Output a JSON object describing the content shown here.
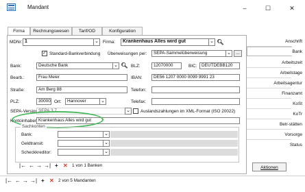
{
  "window": {
    "title": "Mandant",
    "minimize": "–",
    "maximize": "☐",
    "close": "✕"
  },
  "tabs": [
    "Firma",
    "Rechnungswesen",
    "Tarif/OD",
    "Konfiguration"
  ],
  "form": {
    "mdnr_label": "MDNr:",
    "mdnr_value": "1",
    "firma_label": "Firma:",
    "firma_value": "Krankenhaus Alles wird gut",
    "standard_bank_label": "Standard-Bankverbindung",
    "ueberweisungen_label": "Überweisungen per:",
    "ueberweisungen_value": "SEPA-Sammelüberweisung",
    "ellipsis_label": "...",
    "bank_label": "Bank:",
    "bank_value": "Deutsche Bank",
    "blz_label": "BLZ:",
    "blz_value": "12070000",
    "bic_label": "BIC:",
    "bic_value": "DEUTDEBB120",
    "bearb_label": "Bearb.:",
    "bearb_value": "Frau Meier",
    "iban_label": "IBAN:",
    "iban_value": "DE56 1207 0000 0099 9991 23",
    "strasse_label": "Straße:",
    "strasse_value": "Am Berg 88",
    "telefon_label": "Telefon:",
    "telefon_value": "",
    "plz_label": "PLZ:",
    "plz_value": "30000",
    "ort_label": "Ort:",
    "ort_value": "Hannover",
    "telefax_label": "Telefax:",
    "telefax_value": "",
    "sepa_version_label": "SEPA-Version:",
    "sepa_version_value": "SEPA 3.7",
    "ausland_label": "Auslandszahlungen im XML-Format (ISO 20022)",
    "kontoinhaber_label": "Kontoinhaber:",
    "kontoinhaber_value": "Krankenhaus Alles wird gut",
    "sachkonten_label": "Sachkonten",
    "sk_bank_label": "Bank:",
    "sk_geldtransit_label": "Geldtransit:",
    "sk_scheckkreditor_label": "Scheckkreditor:"
  },
  "icons": {
    "dropdown": "chevron-down-icon",
    "search": "magnifier-icon"
  },
  "inner_nav": {
    "first": "|←",
    "prev": "←",
    "next": "→",
    "last": "→|",
    "add": "+",
    "delete": "✕",
    "record_text": "1 von 1 Banken"
  },
  "outer_nav": {
    "first": "|←",
    "prev": "←",
    "next": "→",
    "last": "→|",
    "add": "+",
    "delete": "✕",
    "record_text": "2 von 5 Mandanten"
  },
  "side_items": [
    "Anschrift",
    "Bank",
    "Arbeitszeit",
    "Arbeitstage",
    "Arbeitsagentur",
    "Finanzamt",
    "KoSt",
    "KoTr",
    "Betr-stätten",
    "Vorsorge",
    "Status"
  ],
  "side_active": "Bank",
  "aktionen_label": "Aktionen",
  "colors": {
    "highlight_ellipse": "#46b85a",
    "delete_red": "#d63a26",
    "app_icon_blue": "#2f6db3"
  }
}
